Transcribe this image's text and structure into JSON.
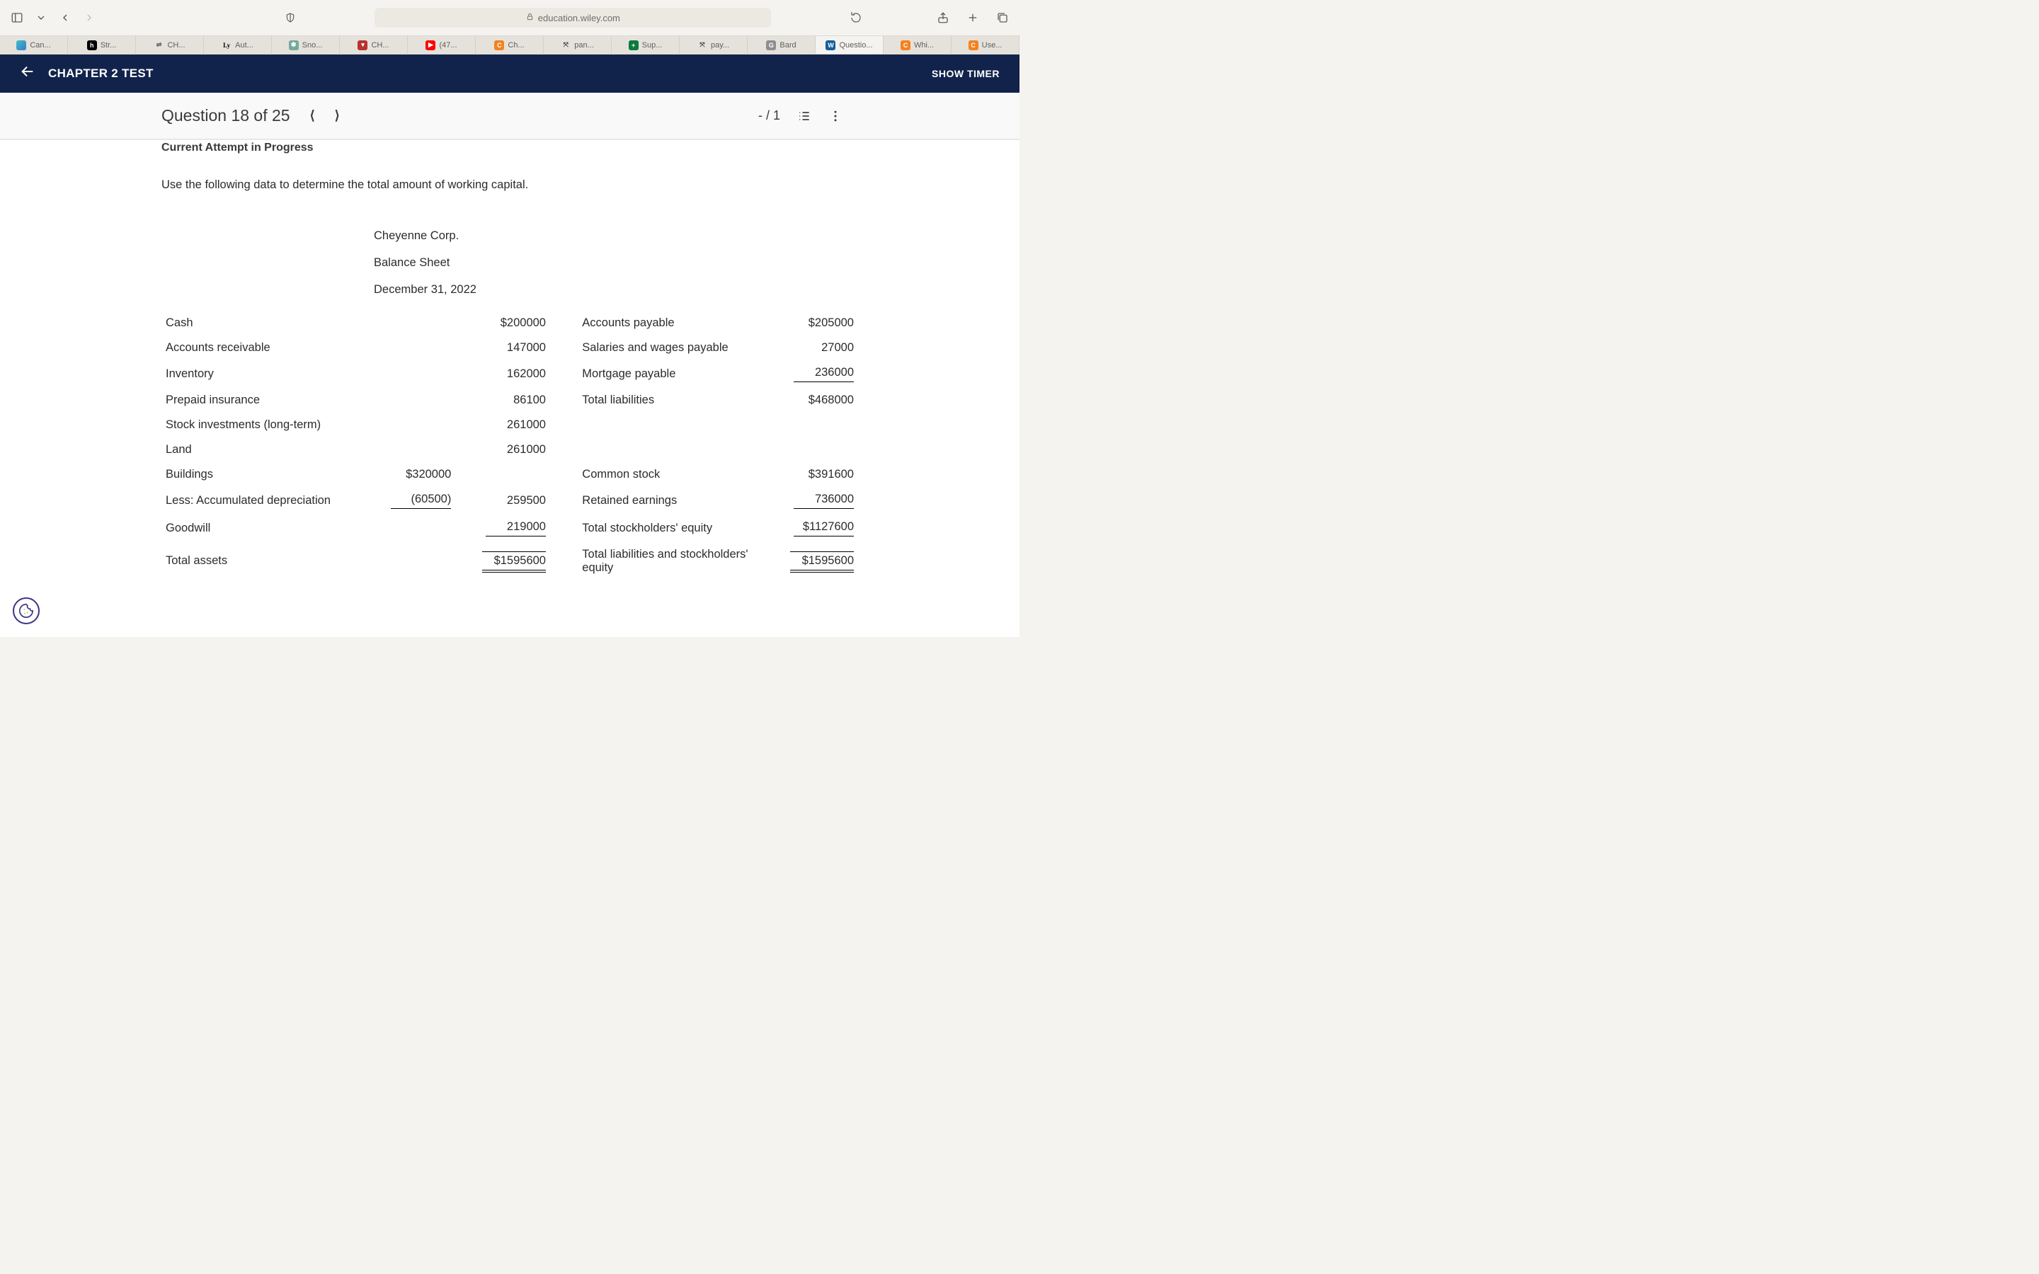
{
  "browser": {
    "url": "education.wiley.com",
    "tabs": [
      {
        "label": "Can...",
        "favstyle": "background:linear-gradient(135deg,#3bc1c9,#3b79c9);"
      },
      {
        "label": "Str...",
        "favstyle": "background:#000;color:#fff;",
        "favtext": "h"
      },
      {
        "label": "CH...",
        "favstyle": "background:transparent;color:#555;",
        "favtext": "⇌"
      },
      {
        "label": "Aut...",
        "favstyle": "background:transparent;color:#000;font-family:serif;",
        "favtext": "Ly"
      },
      {
        "label": "Sno...",
        "favstyle": "background:#74aa9c;",
        "favtext": "✽"
      },
      {
        "label": "CH...",
        "favstyle": "background:#b8332f;",
        "favtext": "▾"
      },
      {
        "label": "(47...",
        "favstyle": "background:#ff0000;",
        "favtext": "▶"
      },
      {
        "label": "Ch...",
        "favstyle": "background:#f5821f;",
        "favtext": "C"
      },
      {
        "label": "pan...",
        "favstyle": "background:transparent;color:#333;",
        "favtext": "⤧"
      },
      {
        "label": "Sup...",
        "favstyle": "background:#0b7b3e;",
        "favtext": "+"
      },
      {
        "label": "pay...",
        "favstyle": "background:transparent;color:#333;",
        "favtext": "⤧"
      },
      {
        "label": "Bard",
        "favstyle": "background:#8e8e8e;",
        "favtext": "G"
      },
      {
        "label": "Questio...",
        "favstyle": "background:#115e9c;",
        "favtext": "W",
        "active": true
      },
      {
        "label": "Whi...",
        "favstyle": "background:#f5821f;",
        "favtext": "C"
      },
      {
        "label": "Use...",
        "favstyle": "background:#f5821f;",
        "favtext": "C"
      }
    ]
  },
  "test_header": {
    "title": "CHAPTER 2 TEST",
    "show_timer": "SHOW TIMER"
  },
  "question_bar": {
    "title": "Question 18 of 25",
    "score": "- / 1"
  },
  "content": {
    "attempt_label": "Current Attempt in Progress",
    "prompt": "Use the following data to determine the total amount of working capital.",
    "company": "Cheyenne Corp.",
    "statement": "Balance Sheet",
    "date": "December 31, 2022",
    "rows": [
      {
        "l": "Cash",
        "lv": "",
        "lv2": "$200000",
        "r": "Accounts payable",
        "rv": "$205000"
      },
      {
        "l": "Accounts receivable",
        "lv": "",
        "lv2": "147000",
        "r": "Salaries and wages payable",
        "rv": "27000"
      },
      {
        "l": "Inventory",
        "lv": "",
        "lv2": "162000",
        "r": "Mortgage payable",
        "rv": "236000",
        "r_under": "single"
      },
      {
        "l": "Prepaid insurance",
        "lv": "",
        "lv2": "86100",
        "r": "Total liabilities",
        "rv": "$468000"
      },
      {
        "l": "Stock investments (long-term)",
        "lv": "",
        "lv2": "261000",
        "r": "",
        "rv": ""
      },
      {
        "l": "Land",
        "lv": "",
        "lv2": "261000",
        "r": "",
        "rv": ""
      },
      {
        "l": "Buildings",
        "lv": "$320000",
        "lv2": "",
        "r": "Common stock",
        "rv": "$391600"
      },
      {
        "l": "Less: Accumulated depreciation",
        "lv": "(60500)",
        "lv2": "259500",
        "r": "Retained earnings",
        "rv": "736000",
        "l_under": "single",
        "r_under": "single"
      },
      {
        "l": "Goodwill",
        "lv": "",
        "lv2": "219000",
        "lv2_under": "single",
        "r": "Total stockholders' equity",
        "rv": "$1127600",
        "r_under": "single"
      },
      {
        "l": "Total assets",
        "lv": "",
        "lv2": "$1595600",
        "lv2_under": "double",
        "r": "Total liabilities and stockholders' equity",
        "rv": "$1595600",
        "rv_under": "double"
      }
    ]
  }
}
